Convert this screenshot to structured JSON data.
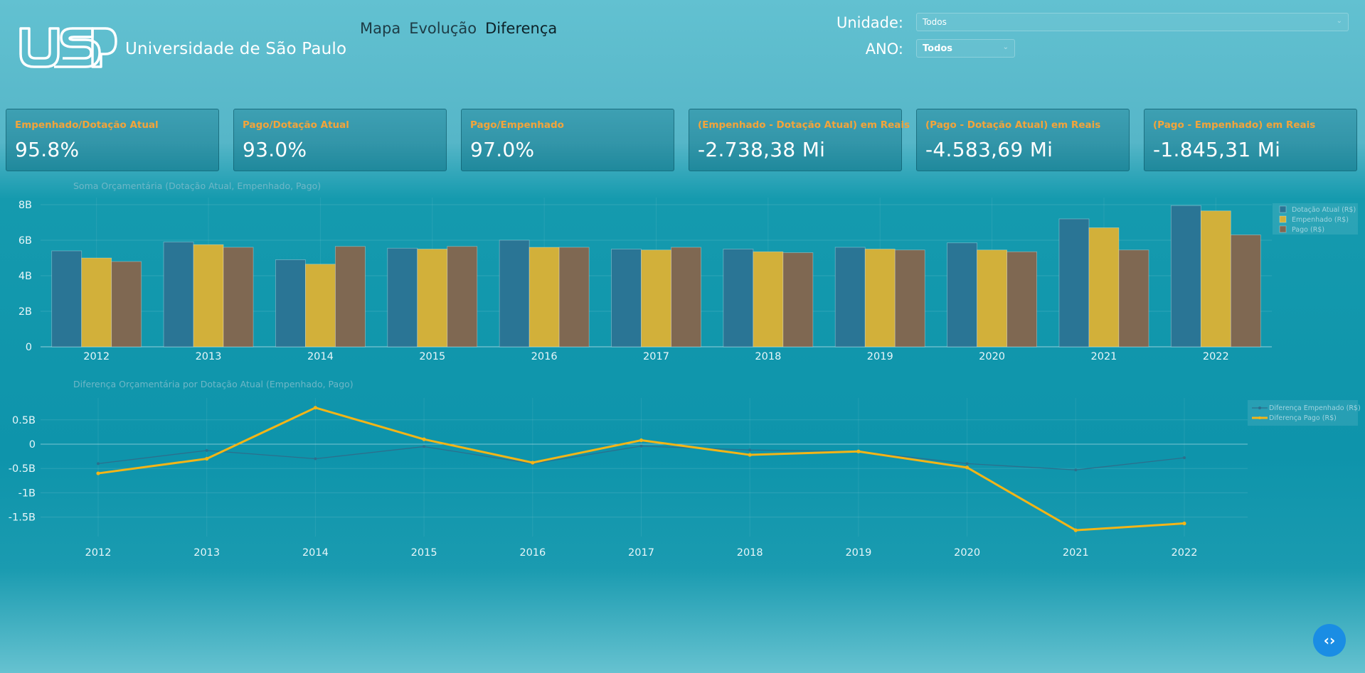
{
  "header": {
    "university_name": "Universidade de São Paulo",
    "nav": [
      {
        "label": "Mapa"
      },
      {
        "label": "Evolução"
      },
      {
        "label": "Diferença"
      }
    ],
    "filters": {
      "unidade_label": "Unidade:",
      "unidade_value": "Todos",
      "ano_label": "ANO:",
      "ano_value": "Todos"
    }
  },
  "kpis": [
    {
      "title": "Empenhado/Dotação Atual",
      "value": "95.8%"
    },
    {
      "title": "Pago/Dotação Atual",
      "value": "93.0%"
    },
    {
      "title": "Pago/Empenhado",
      "value": "97.0%"
    },
    {
      "title": "(Empenhado - Dotação Atual) em Reais",
      "value": "-2.738,38 Mi"
    },
    {
      "title": "(Pago - Dotação Atual) em Reais",
      "value": "-4.583,69 Mi"
    },
    {
      "title": "(Pago - Empenhado) em Reais",
      "value": "-1.845,31 Mi"
    }
  ],
  "colors": {
    "dotacao": "#2a7595",
    "empenhado": "#d2b03a",
    "pago": "#7f6852",
    "dif_empenhado": "#2c6f8d",
    "dif_pago": "#f3b517",
    "fab": "#1a8de4"
  },
  "fab_icon": "code-icon",
  "chart_data": [
    {
      "type": "bar",
      "title": "Soma Orçamentária (Dotação Atual, Empenhado, Pago)",
      "categories": [
        "2012",
        "2013",
        "2014",
        "2015",
        "2016",
        "2017",
        "2018",
        "2019",
        "2020",
        "2021",
        "2022"
      ],
      "ylim": [
        0,
        8.4
      ],
      "yticks": [
        0,
        2,
        4,
        6,
        8
      ],
      "ytick_labels": [
        "0",
        "2B",
        "4B",
        "6B",
        "8B"
      ],
      "legend_position": "top-right",
      "series": [
        {
          "name": "Dotação Atual (R$)",
          "values": [
            5.4,
            5.9,
            4.9,
            5.55,
            6.0,
            5.5,
            5.5,
            5.6,
            5.85,
            7.2,
            7.95
          ]
        },
        {
          "name": "Empenhado (R$)",
          "values": [
            5.0,
            5.75,
            4.65,
            5.5,
            5.6,
            5.45,
            5.35,
            5.5,
            5.45,
            6.7,
            7.65
          ]
        },
        {
          "name": "Pago (R$)",
          "values": [
            4.8,
            5.6,
            5.65,
            5.65,
            5.6,
            5.6,
            5.3,
            5.45,
            5.35,
            5.45,
            6.3
          ]
        }
      ]
    },
    {
      "type": "line",
      "title": "Diferença Orçamentária por Dotação Atual (Empenhado, Pago)",
      "categories": [
        "2012",
        "2013",
        "2014",
        "2015",
        "2016",
        "2017",
        "2018",
        "2019",
        "2020",
        "2021",
        "2022"
      ],
      "ylim": [
        -1.9,
        0.95
      ],
      "yticks": [
        0.5,
        0,
        -0.5,
        -1,
        -1.5
      ],
      "ytick_labels": [
        "0.5B",
        "0",
        "-0.5B",
        "-1B",
        "-1.5B"
      ],
      "legend_position": "top-right",
      "series": [
        {
          "name": "Diferença Empenhado (R$)",
          "values": [
            -0.4,
            -0.13,
            -0.3,
            -0.05,
            -0.4,
            -0.04,
            -0.12,
            -0.15,
            -0.4,
            -0.53,
            -0.28
          ]
        },
        {
          "name": "Diferença Pago (R$)",
          "values": [
            -0.6,
            -0.3,
            0.75,
            0.1,
            -0.38,
            0.08,
            -0.22,
            -0.15,
            -0.48,
            -1.77,
            -1.63
          ]
        }
      ]
    }
  ]
}
